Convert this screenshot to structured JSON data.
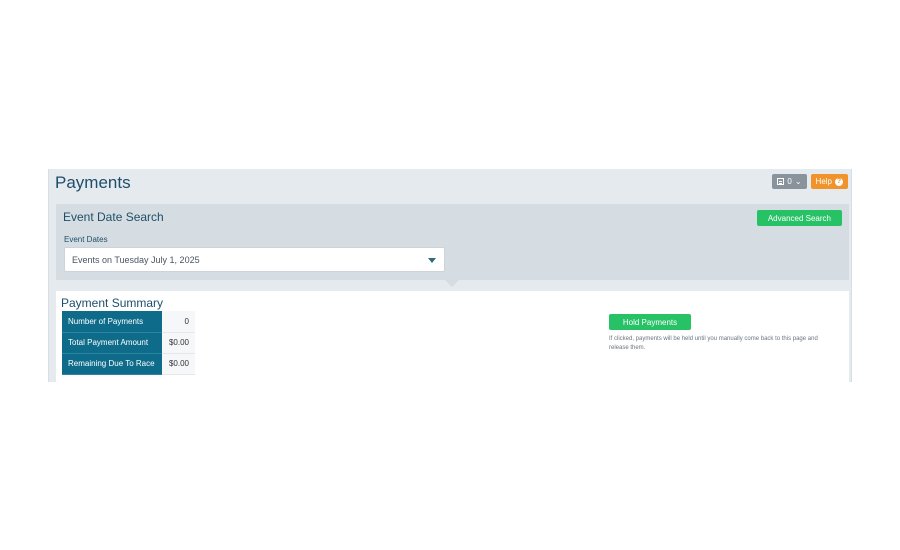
{
  "header": {
    "title": "Payments",
    "counter_value": "0",
    "help_label": "Help"
  },
  "search": {
    "title": "Event Date Search",
    "advanced_label": "Advanced Search",
    "field_label": "Event Dates",
    "selected_value": "Events on Tuesday July 1, 2025"
  },
  "summary": {
    "title": "Payment Summary",
    "rows": [
      {
        "label": "Number of Payments",
        "value": "0"
      },
      {
        "label": "Total Payment Amount",
        "value": "$0.00"
      },
      {
        "label": "Remaining Due To Race",
        "value": "$0.00"
      }
    ],
    "hold_label": "Hold Payments",
    "hold_note": "If clicked, payments will be held until you manually come back to this page and release them."
  },
  "colors": {
    "accent_green": "#27c266",
    "table_header": "#0e6c8a",
    "help_orange": "#f0932b",
    "title_blue": "#1e4e6a"
  },
  "icons": {
    "counter": "list-icon",
    "counter_caret": "chevron-down-icon",
    "help": "question-circle-icon",
    "select_caret": "caret-down-icon"
  }
}
